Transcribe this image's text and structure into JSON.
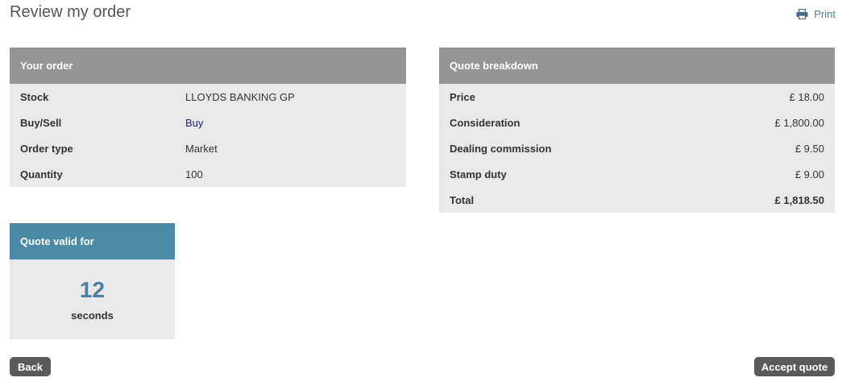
{
  "page": {
    "title": "Review my order",
    "print_label": "Print"
  },
  "your_order": {
    "header": "Your order",
    "rows": [
      {
        "label": "Stock",
        "value": "LLOYDS BANKING GP"
      },
      {
        "label": "Buy/Sell",
        "value": "Buy"
      },
      {
        "label": "Order type",
        "value": "Market"
      },
      {
        "label": "Quantity",
        "value": "100"
      }
    ]
  },
  "quote_breakdown": {
    "header": "Quote breakdown",
    "rows": [
      {
        "label": "Price",
        "value": "£ 18.00"
      },
      {
        "label": "Consideration",
        "value": "£ 1,800.00"
      },
      {
        "label": "Dealing commission",
        "value": "£ 9.50"
      },
      {
        "label": "Stamp duty",
        "value": "£ 9.00"
      },
      {
        "label": "Total",
        "value": "£ 1,818.50"
      }
    ]
  },
  "quote_valid": {
    "header": "Quote valid for",
    "seconds_remaining": "12",
    "unit": "seconds"
  },
  "actions": {
    "back_label": "Back",
    "accept_label": "Accept quote"
  },
  "colors": {
    "panel_header": "#959595",
    "valid_header": "#4a8aa6",
    "panel_body": "#e9e9e9",
    "link": "#4a7ea2",
    "button": "#5a5a5a",
    "buy_text": "#1a237e"
  },
  "icons": {
    "print": "printer-icon"
  }
}
